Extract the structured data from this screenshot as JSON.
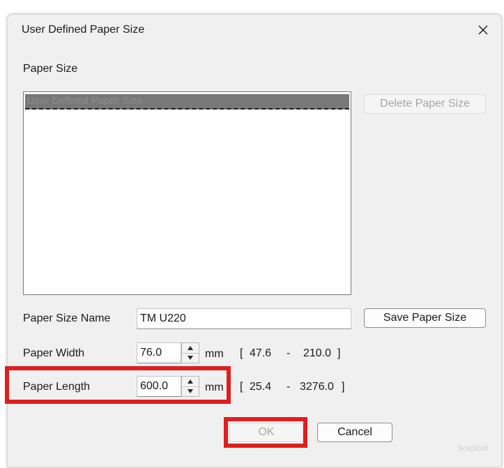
{
  "dialog": {
    "title": "User Defined Paper Size",
    "close_icon": "close-icon"
  },
  "paper_size_section": {
    "label": "Paper Size",
    "list_items": [
      "User Defined Paper Size"
    ],
    "delete_button": "Delete Paper Size"
  },
  "paper_size_name": {
    "label": "Paper Size Name",
    "value": "TM U220",
    "save_button": "Save Paper Size"
  },
  "paper_width": {
    "label": "Paper Width",
    "value": "76.0",
    "unit": "mm",
    "range_open": "[",
    "range_min": "47.6",
    "range_sep": "-",
    "range_max": "210.0",
    "range_close": "]"
  },
  "paper_length": {
    "label": "Paper Length",
    "value": "600.0",
    "unit": "mm",
    "range_open": "[",
    "range_min": "25.4",
    "range_sep": "-",
    "range_max": "3276.0",
    "range_close": "]"
  },
  "footer": {
    "ok_button": "OK",
    "cancel_button": "Cancel"
  },
  "watermark": "SnapEdit",
  "colors": {
    "highlight_red": "#e11d1d",
    "dialog_bg": "#f0f0f0",
    "selected_row": "#787878"
  }
}
